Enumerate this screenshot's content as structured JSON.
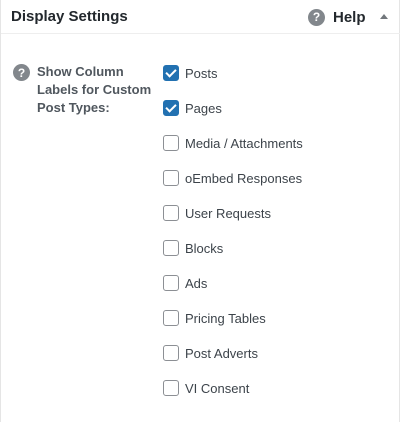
{
  "header": {
    "title": "Display Settings",
    "help_label": "Help",
    "help_icon": "question-circle-icon",
    "toggle_icon": "triangle-up-icon"
  },
  "field": {
    "label": "Show Column Labels for Custom Post Types:",
    "help_icon": "question-circle-icon"
  },
  "options": [
    {
      "label": "Posts",
      "checked": true
    },
    {
      "label": "Pages",
      "checked": true
    },
    {
      "label": "Media / Attachments",
      "checked": false
    },
    {
      "label": "oEmbed Responses",
      "checked": false
    },
    {
      "label": "User Requests",
      "checked": false
    },
    {
      "label": "Blocks",
      "checked": false
    },
    {
      "label": "Ads",
      "checked": false
    },
    {
      "label": "Pricing Tables",
      "checked": false
    },
    {
      "label": "Post Adverts",
      "checked": false
    },
    {
      "label": "VI Consent",
      "checked": false
    }
  ],
  "colors": {
    "accent": "#2271b1",
    "icon_gray": "#82878c"
  }
}
